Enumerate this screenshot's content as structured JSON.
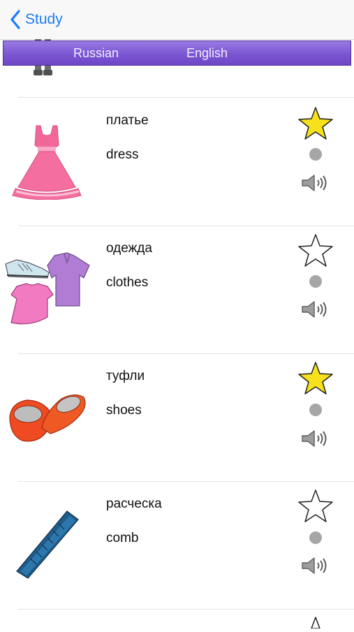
{
  "navbar": {
    "back_label": "Study"
  },
  "header": {
    "left_language": "Russian",
    "right_language": "English"
  },
  "rows": [
    {
      "image": "dress-illustration",
      "russian": "платье",
      "english": "dress",
      "favorite": true
    },
    {
      "image": "clothes-illustration",
      "russian": "одежда",
      "english": "clothes",
      "favorite": false
    },
    {
      "image": "shoes-illustration",
      "russian": "туфли",
      "english": "shoes",
      "favorite": true
    },
    {
      "image": "comb-illustration",
      "russian": "расческа",
      "english": "comb",
      "favorite": false
    }
  ],
  "colors": {
    "accent": "#1a7cf5",
    "header_bar": "#7b56d2",
    "star_filled": "#f7e11c",
    "status_dot": "#a6a6a6"
  },
  "icons": [
    "chevron-left-icon",
    "star-icon",
    "status-dot",
    "speaker-icon"
  ]
}
